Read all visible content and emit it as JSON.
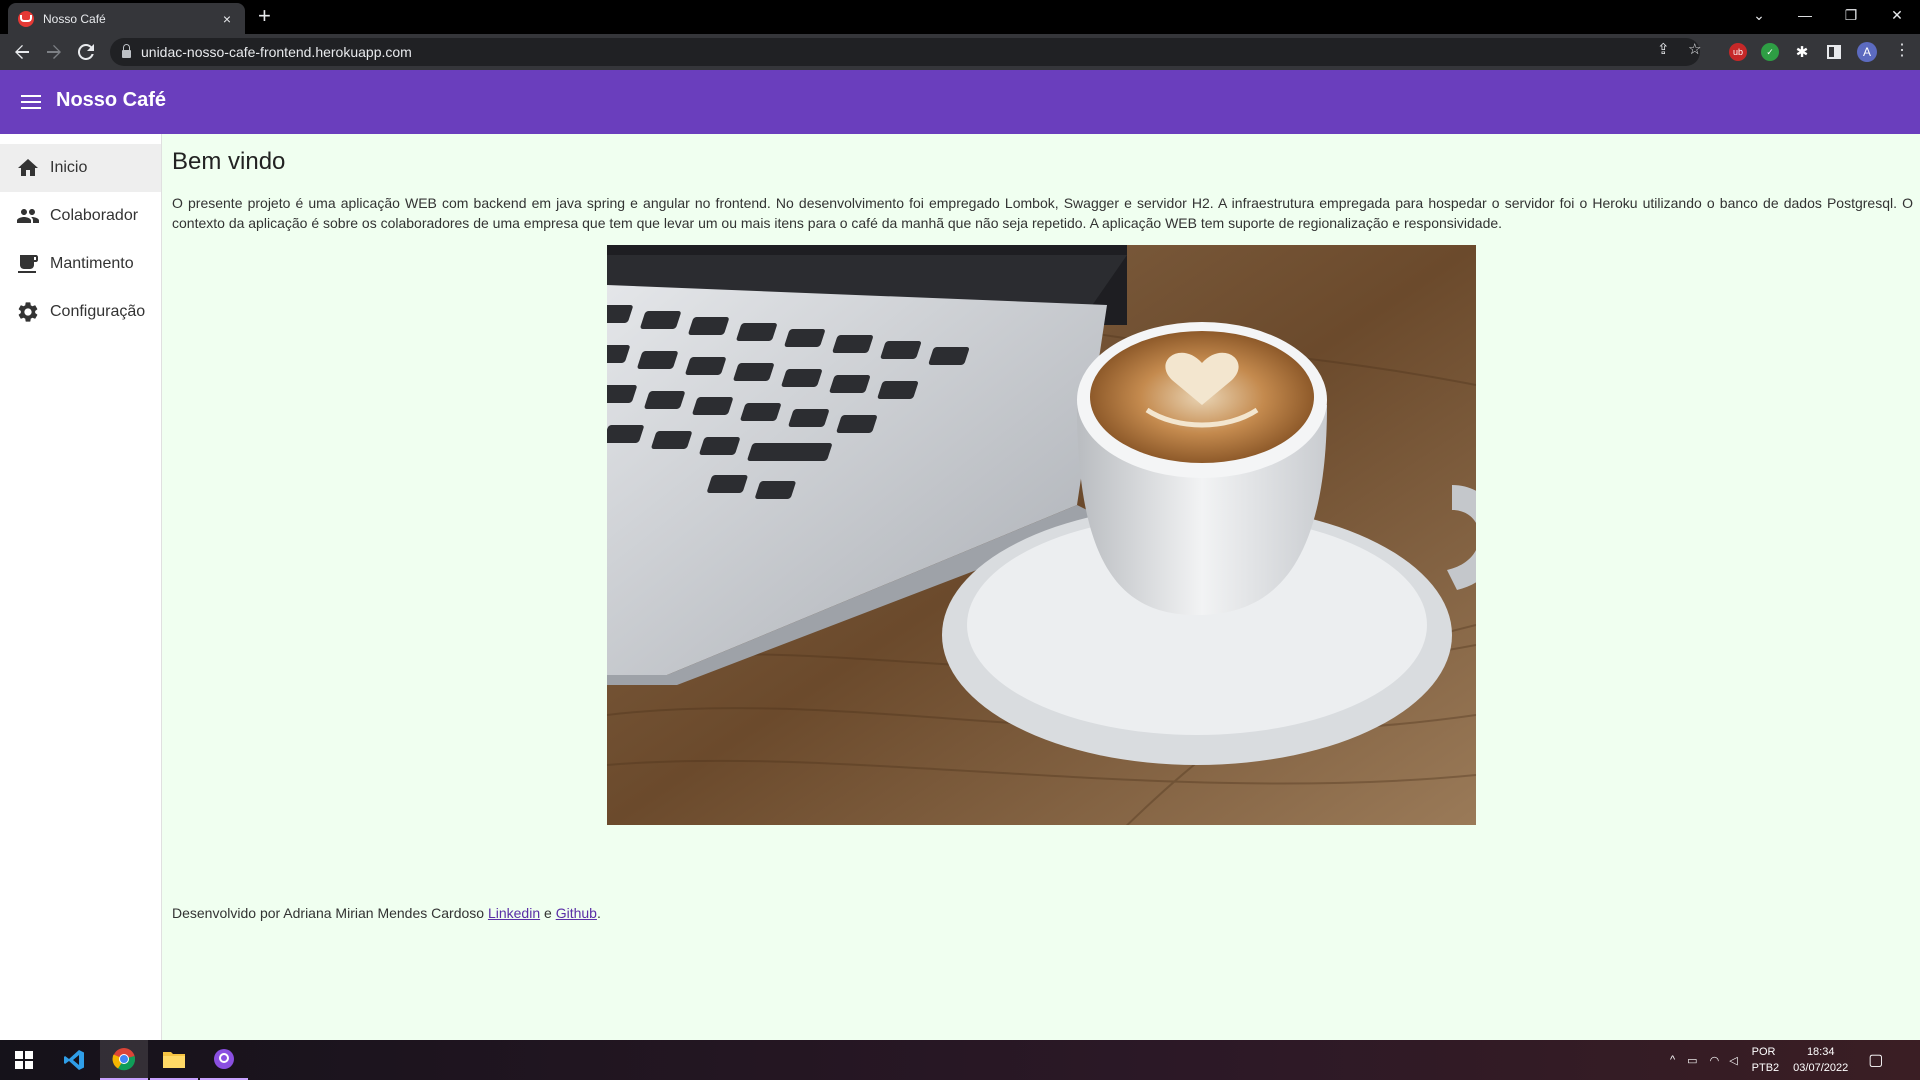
{
  "browser": {
    "tab_title": "Nosso Café",
    "tab_close": "×",
    "new_tab": "+",
    "url": "unidac-nosso-cafe-frontend.herokuapp.com",
    "profile_initial": "A",
    "window_controls": {
      "dropdown": "⌄",
      "minimize": "—",
      "restore": "❐",
      "close": "✕"
    }
  },
  "app": {
    "title": "Nosso Café",
    "accent_color": "#6a3ebd",
    "background_color": "#f0fff0"
  },
  "sidebar": {
    "items": [
      {
        "label": "Inicio",
        "icon": "home-icon",
        "active": true
      },
      {
        "label": "Colaborador",
        "icon": "people-icon",
        "active": false
      },
      {
        "label": "Mantimento",
        "icon": "coffee-icon",
        "active": false
      },
      {
        "label": "Configuração",
        "icon": "gear-icon",
        "active": false
      }
    ]
  },
  "main": {
    "heading": "Bem vindo",
    "description": "O presente projeto é uma aplicação WEB com backend em java spring e angular no frontend. No desenvolvimento foi empregado Lombok, Swagger e servidor H2. A infraestrutura empregada para hospedar o servidor foi o Heroku utilizando o banco de dados Postgresql. O contexto da aplicação é sobre os colaboradores de uma empresa que tem que levar um ou mais itens para o café da manhã que não seja repetido. A aplicação WEB tem suporte de regionalização e responsividade.",
    "footer": {
      "prefix": "Desenvolvido por Adriana Mirian Mendes Cardoso ",
      "linkedin": "Linkedin",
      "connector": " e ",
      "github": "Github",
      "suffix": "."
    }
  },
  "taskbar": {
    "lang_top": "POR",
    "lang_bottom": "PTB2",
    "time": "18:34",
    "date": "03/07/2022"
  }
}
